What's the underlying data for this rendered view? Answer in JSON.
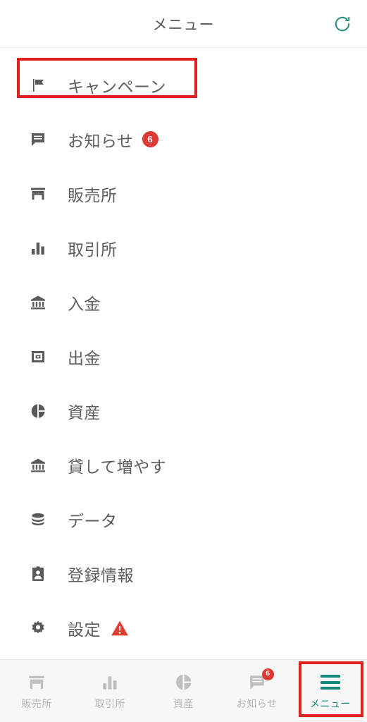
{
  "header": {
    "title": "メニュー",
    "refresh_icon": "refresh-icon",
    "refresh_color": "#2e9182"
  },
  "annotations": {
    "highlight_color": "#e02020",
    "campaign_box": "highlight-campaign-row",
    "menu_tab_box": "highlight-menu-tab"
  },
  "menu": {
    "items": [
      {
        "label": "キャンペーン",
        "icon": "flag-icon",
        "badge": null,
        "warning": false
      },
      {
        "label": "お知らせ",
        "icon": "announcement-icon",
        "badge": "6",
        "warning": false
      },
      {
        "label": "販売所",
        "icon": "storefront-icon",
        "badge": null,
        "warning": false
      },
      {
        "label": "取引所",
        "icon": "bar-chart-icon",
        "badge": null,
        "warning": false
      },
      {
        "label": "入金",
        "icon": "bank-icon",
        "badge": null,
        "warning": false
      },
      {
        "label": "出金",
        "icon": "wallet-icon",
        "badge": null,
        "warning": false
      },
      {
        "label": "資産",
        "icon": "pie-chart-icon",
        "badge": null,
        "warning": false
      },
      {
        "label": "貸して増やす",
        "icon": "bank-icon",
        "badge": null,
        "warning": false
      },
      {
        "label": "データ",
        "icon": "database-icon",
        "badge": null,
        "warning": false
      },
      {
        "label": "登録情報",
        "icon": "id-badge-icon",
        "badge": null,
        "warning": false
      },
      {
        "label": "設定",
        "icon": "gear-icon",
        "badge": null,
        "warning": true
      }
    ],
    "text_color": "#5e5e60",
    "icon_color": "#5a5a5a",
    "badge_color": "#dc3a33",
    "warning_color": "#e03c31"
  },
  "bottom_nav": {
    "active_color": "#17897a",
    "inactive_color": "#b4b4b4",
    "items": [
      {
        "label": "販売所",
        "icon": "storefront-icon",
        "badge": null,
        "active": false
      },
      {
        "label": "取引所",
        "icon": "bar-chart-icon",
        "badge": null,
        "active": false
      },
      {
        "label": "資産",
        "icon": "pie-chart-icon",
        "badge": null,
        "active": false
      },
      {
        "label": "お知らせ",
        "icon": "announcement-icon",
        "badge": "6",
        "active": false
      },
      {
        "label": "メニュー",
        "icon": "hamburger-icon",
        "badge": null,
        "active": true
      }
    ]
  }
}
